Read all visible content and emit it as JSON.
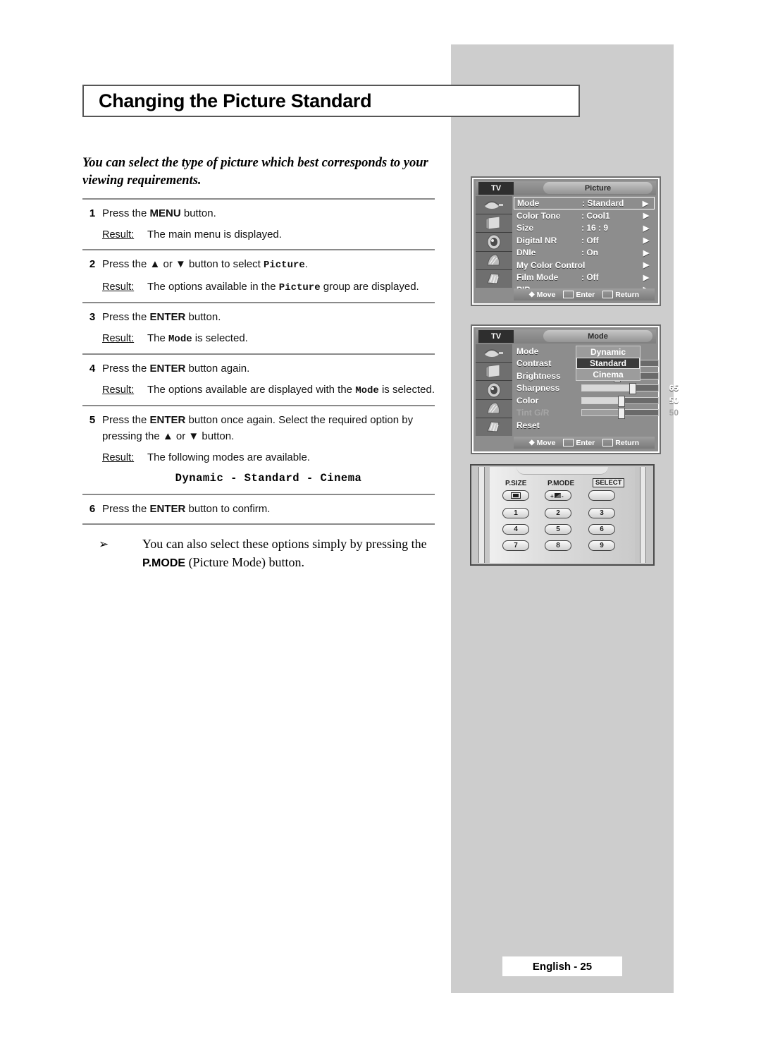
{
  "page": {
    "title": "Changing the Picture Standard",
    "intro": "You can select the type of picture which best corresponds to your viewing requirements.",
    "footer": "English - 25",
    "accent_gray": "#cdcdcd",
    "osd_gray": "#8d8d8d"
  },
  "steps": [
    {
      "num": "1",
      "text_pre": "Press the ",
      "text_bold": "MENU",
      "text_post": " button.",
      "result_label": "Result:",
      "result": "The main menu is displayed."
    },
    {
      "num": "2",
      "text_pre": "Press the ▲ or ▼ button to select ",
      "text_mono": "Picture",
      "text_post": ".",
      "result_label": "Result:",
      "result_pre": "The options available in the ",
      "result_mono": "Picture",
      "result_post": " group are displayed."
    },
    {
      "num": "3",
      "text_pre": "Press the ",
      "text_bold": "ENTER",
      "text_post": " button.",
      "result_label": "Result:",
      "result_pre": "The ",
      "result_mono": "Mode",
      "result_post": " is selected."
    },
    {
      "num": "4",
      "text_pre": "Press the ",
      "text_bold": "ENTER",
      "text_post": " button again.",
      "result_label": "Result:",
      "result_pre": "The options available are displayed with the ",
      "result_mono": "Mode",
      "result_post": " is selected."
    },
    {
      "num": "5",
      "text_pre": "Press the ",
      "text_bold": "ENTER",
      "text_post": " button once again. Select the required option by pressing the ▲ or ▼ button.",
      "result_label": "Result:",
      "result": "The following modes are available.",
      "modes": "Dynamic - Standard - Cinema"
    },
    {
      "num": "6",
      "text_pre": "Press the ",
      "text_bold": "ENTER",
      "text_post": " button to confirm."
    }
  ],
  "note": {
    "bullet": "➢",
    "pre": "You can also select these options simply by pressing the ",
    "bold": "P.MODE",
    "post": " (Picture Mode) button."
  },
  "osd_picture": {
    "tv_label": "TV",
    "tab_label": "Picture",
    "rows": [
      {
        "name": "Mode",
        "value": ": Standard",
        "arrow": "▶",
        "selected": true
      },
      {
        "name": "Color Tone",
        "value": ": Cool1",
        "arrow": "▶",
        "selected": false
      },
      {
        "name": "Size",
        "value": ": 16 : 9",
        "arrow": "▶",
        "selected": false
      },
      {
        "name": "Digital NR",
        "value": ": Off",
        "arrow": "▶",
        "selected": false
      },
      {
        "name": "DNIe",
        "value": ": On",
        "arrow": "▶",
        "selected": false
      },
      {
        "name": "My Color Control",
        "value": "",
        "arrow": "▶",
        "selected": false
      },
      {
        "name": "Film Mode",
        "value": ": Off",
        "arrow": "▶",
        "selected": false
      },
      {
        "name": "PIP",
        "value": "",
        "arrow": "▶",
        "selected": false
      }
    ],
    "footer": {
      "move": "Move",
      "enter": "Enter",
      "return": "Return"
    }
  },
  "osd_mode": {
    "tv_label": "TV",
    "tab_label": "Mode",
    "mode_row": {
      "name": "Mode",
      "colon": ":"
    },
    "dropdown": [
      {
        "label": "Dynamic",
        "selected": false
      },
      {
        "label": "Standard",
        "selected": true
      },
      {
        "label": "Cinema",
        "selected": false
      }
    ],
    "sliders": [
      {
        "name": "Contrast",
        "value": "",
        "percent": 60,
        "dim": false
      },
      {
        "name": "Brightness",
        "value": "",
        "percent": 45,
        "dim": false
      },
      {
        "name": "Sharpness",
        "value": "65",
        "percent": 65,
        "dim": false
      },
      {
        "name": "Color",
        "value": "50",
        "percent": 50,
        "dim": false
      },
      {
        "name": "Tint G/R",
        "value": "50",
        "percent": 50,
        "dim": true
      }
    ],
    "reset": "Reset",
    "footer": {
      "move": "Move",
      "enter": "Enter",
      "return": "Return"
    }
  },
  "remote": {
    "labels": {
      "psize": "P.SIZE",
      "pmode": "P.MODE",
      "select": "SELECT"
    },
    "keypad": [
      "1",
      "2",
      "3",
      "4",
      "5",
      "6",
      "7",
      "8",
      "9"
    ]
  }
}
